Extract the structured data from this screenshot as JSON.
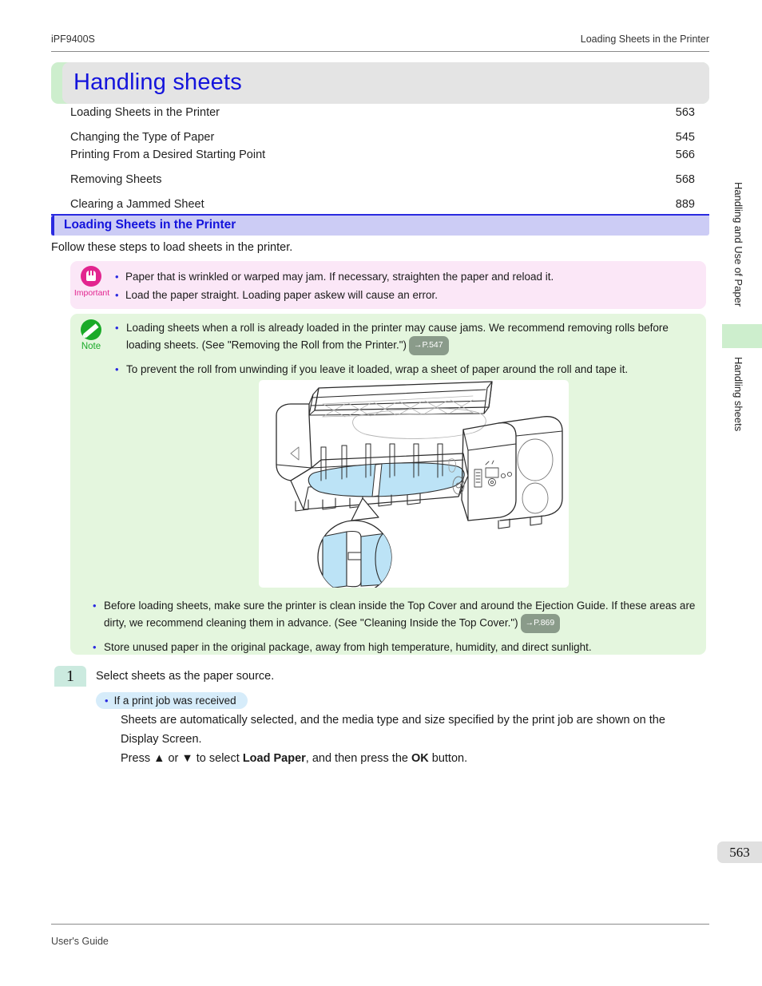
{
  "header": {
    "model": "iPF9400S",
    "running_title": "Loading Sheets in the Printer"
  },
  "chapter": {
    "title": "Handling sheets"
  },
  "toc": [
    {
      "label": "Loading Sheets in the Printer",
      "page": "563",
      "gap": false
    },
    {
      "label": "Changing the Type of Paper",
      "page": "545",
      "gap": true
    },
    {
      "label": "Printing From a Desired Starting Point",
      "page": "566",
      "gap": false
    },
    {
      "label": "Removing Sheets",
      "page": "568",
      "gap": true
    },
    {
      "label": "Clearing a Jammed Sheet",
      "page": "889",
      "gap": true
    }
  ],
  "section": {
    "heading": "Loading Sheets in the Printer",
    "lead": "Follow these steps to load sheets in the printer."
  },
  "important": {
    "label": "Important",
    "icon": "hand-stop-icon",
    "items": [
      "Paper that is wrinkled or warped may jam. If necessary, straighten the paper and reload it.",
      "Load the paper straight. Loading paper askew will cause an error."
    ]
  },
  "note": {
    "label": "Note",
    "icon": "pencil-icon",
    "items_top": [
      {
        "text": "Loading sheets when a roll is already loaded in the printer may cause jams. We recommend removing rolls before loading sheets.  (See \"Removing the Roll from the Printer.\")",
        "ref": "→P.547"
      },
      {
        "text": "To prevent the roll from unwinding if you leave it loaded, wrap a sheet of paper around the roll and tape it.",
        "ref": ""
      }
    ],
    "items_bottom": [
      {
        "text": "Before loading sheets, make sure the printer is clean inside the Top Cover and around the Ejection Guide. If these areas are dirty, we recommend cleaning them in advance.  (See \"Cleaning Inside the Top Cover.\")",
        "ref": "→P.869"
      },
      {
        "text": "Store unused paper in the original package, away from high temperature, humidity, and direct sunlight.",
        "ref": ""
      }
    ],
    "illustration": "large-format-printer-with-loaded-roll-illustration"
  },
  "step": {
    "number": "1",
    "text": "Select sheets as the paper source.",
    "sub_heading": "If a print job was received",
    "body_line_1": "Sheets are automatically selected, and the media type and size specified by the print job are shown on the",
    "body_line_2": "Display Screen.",
    "press_prefix": "Press ▲ or ▼ to select ",
    "press_bold_1": "Load Paper",
    "press_middle": ", and then press the ",
    "press_bold_2": "OK",
    "press_suffix": " button."
  },
  "side_tabs": {
    "upper": "Handling and Use of Paper",
    "lower": "Handling sheets"
  },
  "page_number": "563",
  "footer": {
    "text": "User's Guide"
  },
  "colors": {
    "title_blue": "#1414dc",
    "chapter_band_green": "#cdeecd",
    "chapter_band_gray": "#e4e4e4",
    "section_lavender": "#ccccf5",
    "important_pink": "#fbe7f7",
    "important_magenta": "#e2258f",
    "note_green_bg": "#e4f6de",
    "note_green": "#1aaa28",
    "step_mint": "#cbeadf",
    "sub_head_blue": "#d6ecfa",
    "ref_badge_gray": "#8a9b8a",
    "paper_roll_blue": "#b9e2f5"
  }
}
